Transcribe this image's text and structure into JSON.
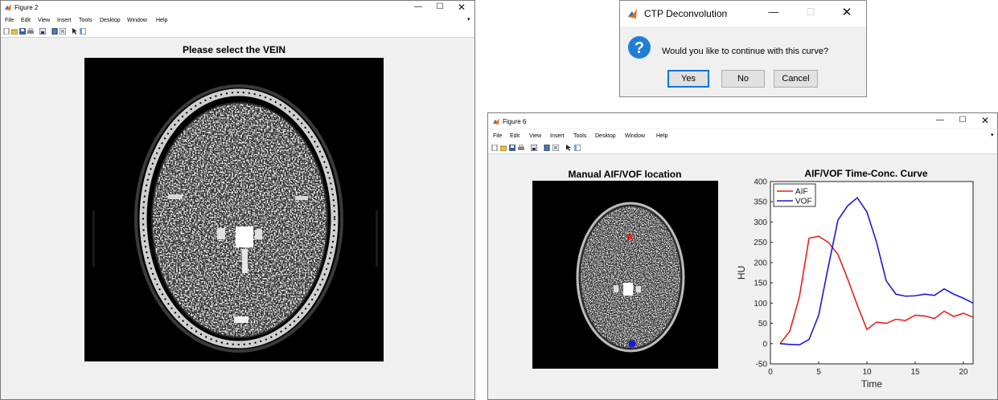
{
  "fig2": {
    "title": "Figure 2",
    "menu": [
      "File",
      "Edit",
      "View",
      "Insert",
      "Tools",
      "Desktop",
      "Window",
      "Help"
    ],
    "plot_title": "Please select the VEIN",
    "window_controls": [
      "minimize-icon",
      "maximize-icon",
      "close-icon"
    ]
  },
  "dialog": {
    "title": "CTP Deconvolution",
    "message": "Would you like to continue with this curve?",
    "buttons": {
      "yes": "Yes",
      "no": "No",
      "cancel": "Cancel"
    },
    "icon": "question-icon"
  },
  "fig6": {
    "title": "Figure 6",
    "menu": [
      "File",
      "Edit",
      "View",
      "Insert",
      "Tools",
      "Desktop",
      "Window",
      "Help"
    ],
    "left_title": "Manual AIF/VOF location",
    "right_title": "AIF/VOF Time-Conc. Curve"
  },
  "colors": {
    "aif": "#e8211d",
    "vof": "#1a1ad6",
    "matlab_blue": "#1f73c7"
  },
  "chart_data": {
    "type": "line",
    "title": "AIF/VOF Time-Conc. Curve",
    "xlabel": "Time",
    "ylabel": "HU",
    "xlim": [
      0,
      21
    ],
    "ylim": [
      -50,
      400
    ],
    "xticks": [
      0,
      5,
      10,
      15,
      20
    ],
    "yticks": [
      -50,
      0,
      50,
      100,
      150,
      200,
      250,
      300,
      350,
      400
    ],
    "grid": false,
    "legend_position": "top-left",
    "series": [
      {
        "name": "AIF",
        "color": "#e8211d",
        "x": [
          1,
          2,
          3,
          4,
          5,
          6,
          7,
          8,
          9,
          10,
          11,
          12,
          13,
          14,
          15,
          16,
          17,
          18,
          19,
          20,
          21
        ],
        "y": [
          0,
          30,
          115,
          260,
          265,
          250,
          220,
          160,
          95,
          35,
          53,
          50,
          60,
          57,
          70,
          68,
          62,
          80,
          67,
          75,
          65
        ]
      },
      {
        "name": "VOF",
        "color": "#1a1ad6",
        "x": [
          1,
          2,
          3,
          4,
          5,
          6,
          7,
          8,
          9,
          10,
          11,
          12,
          13,
          14,
          15,
          16,
          17,
          18,
          19,
          20,
          21
        ],
        "y": [
          0,
          -2,
          -3,
          10,
          70,
          190,
          305,
          340,
          360,
          325,
          250,
          155,
          122,
          117,
          118,
          122,
          119,
          135,
          122,
          112,
          100
        ]
      }
    ]
  }
}
